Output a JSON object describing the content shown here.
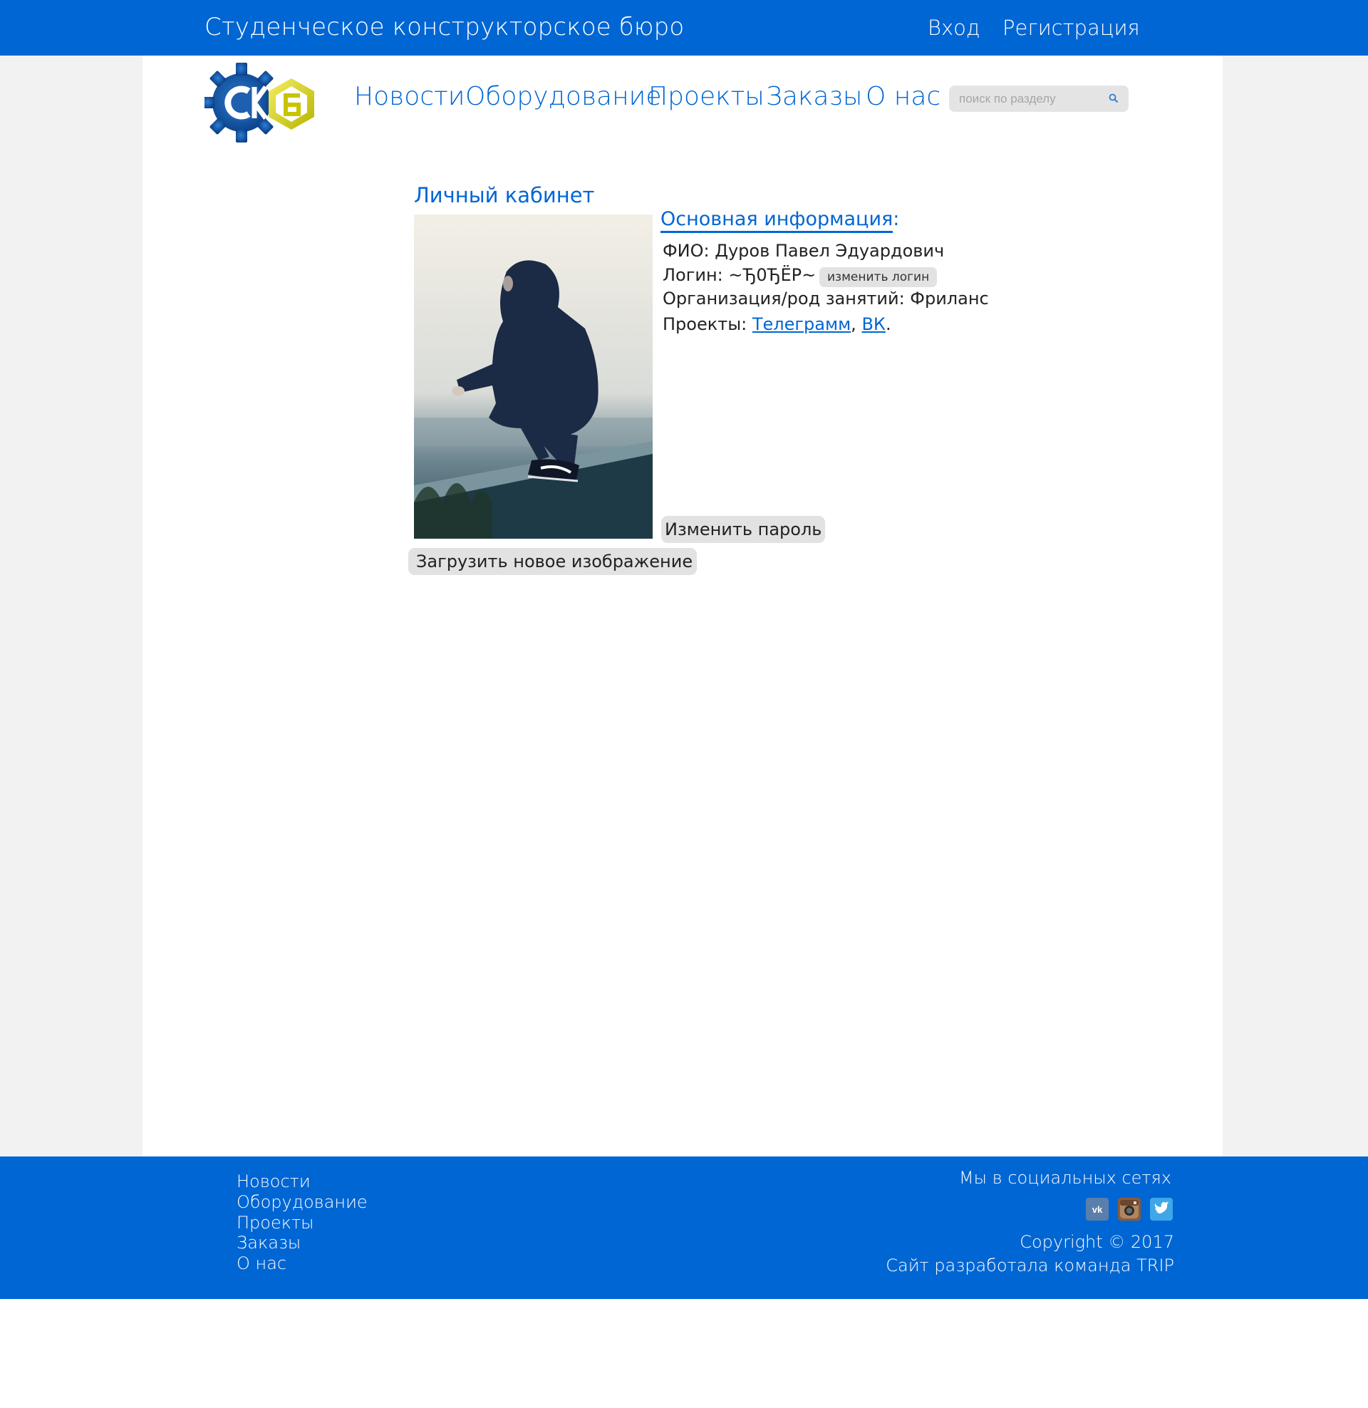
{
  "header": {
    "site_title": "Студенческое конструкторское бюро",
    "login_link": "Вход",
    "register_link": "Регистрация"
  },
  "nav": {
    "items": [
      "Новости",
      "Оборудование",
      "Проекты",
      "Заказы",
      "О нас"
    ]
  },
  "search": {
    "placeholder": "поиск по разделу",
    "icon": "search-icon"
  },
  "cabinet": {
    "title": "Личный кабинет",
    "info_title": "Основная информация",
    "info_colon": ":",
    "fio_label": "ФИО: ",
    "fio_value": "Дуров Павел Эдуардович",
    "login_label": "Логин: ",
    "login_value": "~Ђ0ЂЁР~",
    "change_login_button": "изменить логин",
    "org_label": "Организация/род занятий: ",
    "org_value": "Фриланс",
    "projects_label": "Проекты: ",
    "projects": [
      "Телеграмм",
      "ВК"
    ],
    "projects_sep": ", ",
    "projects_end": ".",
    "change_password_button": "Изменить пароль",
    "upload_image_button": "Загрузить новое изображение"
  },
  "footer": {
    "links": [
      "Новости",
      "Оборудование",
      "Проекты",
      "Заказы",
      "О нас"
    ],
    "social_title": "Мы в социальных сетях",
    "social_icons": [
      "vk-icon",
      "instagram-icon",
      "twitter-icon"
    ],
    "copyright": "Copyright © 2017",
    "credits": "Сайт разработала команда TRIP"
  },
  "colors": {
    "brand_blue": "#0066d4",
    "page_gray": "#f2f2f2",
    "button_gray": "#e2e2e2"
  }
}
